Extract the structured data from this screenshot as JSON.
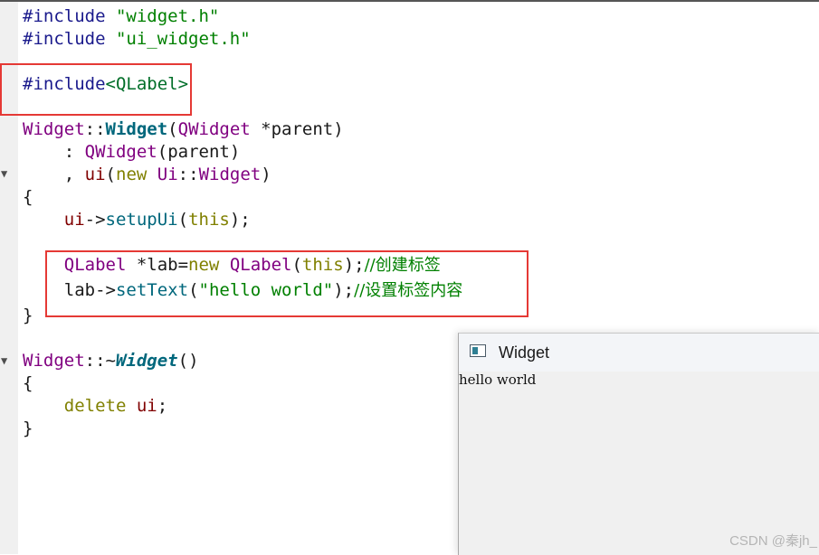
{
  "code": {
    "l1": {
      "directive": "#include",
      "header": "\"widget.h\""
    },
    "l2": {
      "directive": "#include",
      "header": "\"ui_widget.h\""
    },
    "l3": {
      "directive": "#include",
      "header": "<QLabel>"
    },
    "l4": {
      "cls": "Widget",
      "sep": "::",
      "fn": "Widget",
      "open": "(",
      "ptype": "QWidget",
      "star": " *",
      "param": "parent",
      "close": ")"
    },
    "l5": {
      "colon": ": ",
      "base": "QWidget",
      "open": "(",
      "arg": "parent",
      "close": ")"
    },
    "l6": {
      "comma": ", ",
      "member": "ui",
      "open": "(",
      "kw": "new",
      "ns": "Ui",
      "sep": "::",
      "cls": "Widget",
      "close": ")"
    },
    "l7": {
      "text": "{"
    },
    "l8": {
      "obj": "ui",
      "arrow": "->",
      "fn": "setupUi",
      "open": "(",
      "kw": "this",
      "close": ");"
    },
    "l9": {
      "cls": "QLabel",
      "decl": " *lab=",
      "kw": "new",
      "cls2": "QLabel",
      "open": "(",
      "kw2": "this",
      "close": ");",
      "comment": "//创建标签"
    },
    "l10": {
      "obj": "lab",
      "arrow": "->",
      "fn": "setText",
      "open": "(",
      "str": "\"hello world\"",
      "close": ");",
      "comment": "//设置标签内容"
    },
    "l11": {
      "text": "}"
    },
    "l12": {
      "cls": "Widget",
      "sep": "::",
      "tilde": "~",
      "fn": "Widget",
      "parens": "()"
    },
    "l13": {
      "text": "{"
    },
    "l14": {
      "kw": "delete",
      "var": "ui",
      "semi": ";"
    },
    "l15": {
      "text": "}"
    }
  },
  "fold_markers": {
    "symbol": "▼"
  },
  "window": {
    "title": "Widget",
    "label_text": "hello world"
  },
  "watermark": "CSDN @秦jh_",
  "colors": {
    "highlight_box": "#e53935",
    "keyword": "#808000",
    "class": "#800080",
    "string": "#008000"
  }
}
